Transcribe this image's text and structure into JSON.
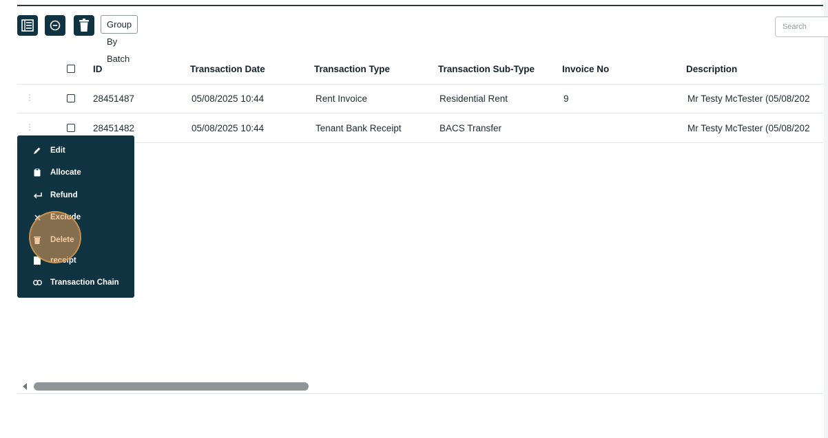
{
  "toolbar": {
    "list_icon": "list-icon",
    "minus_icon": "minus-circle-icon",
    "trash_icon": "trash-icon",
    "group_by_batch_label": "Group By Batch",
    "accent_color": "#0f3340"
  },
  "search": {
    "placeholder": "Search"
  },
  "table": {
    "headers": {
      "id": "ID",
      "transaction_date": "Transaction Date",
      "transaction_type": "Transaction Type",
      "transaction_sub_type": "Transaction Sub-Type",
      "invoice_no": "Invoice No",
      "description": "Description"
    },
    "rows": [
      {
        "id": "28451487",
        "transaction_date": "05/08/2025 10:44",
        "transaction_type": "Rent Invoice",
        "transaction_sub_type": "Residential Rent",
        "invoice_no": "9",
        "description": "Mr Testy McTester (05/08/202"
      },
      {
        "id": "28451482",
        "transaction_date": "05/08/2025 10:44",
        "transaction_type": "Tenant Bank Receipt",
        "transaction_sub_type": "BACS Transfer",
        "invoice_no": "",
        "description": "Mr Testy McTester (05/08/202"
      }
    ]
  },
  "context_menu": {
    "items": [
      {
        "label": "Edit",
        "icon": "pencil-icon"
      },
      {
        "label": "Allocate",
        "icon": "clipboard-icon"
      },
      {
        "label": "Refund",
        "icon": "return-arrow-icon"
      },
      {
        "label": "Exclude",
        "icon": "close-icon"
      },
      {
        "label": "Delete",
        "icon": "trash-icon"
      },
      {
        "label": "receipt",
        "icon": "document-icon"
      },
      {
        "label": "Transaction Chain",
        "icon": "link-icon"
      }
    ],
    "highlighted": "Delete"
  },
  "scrollbar": {
    "position_fraction": 0.0
  }
}
